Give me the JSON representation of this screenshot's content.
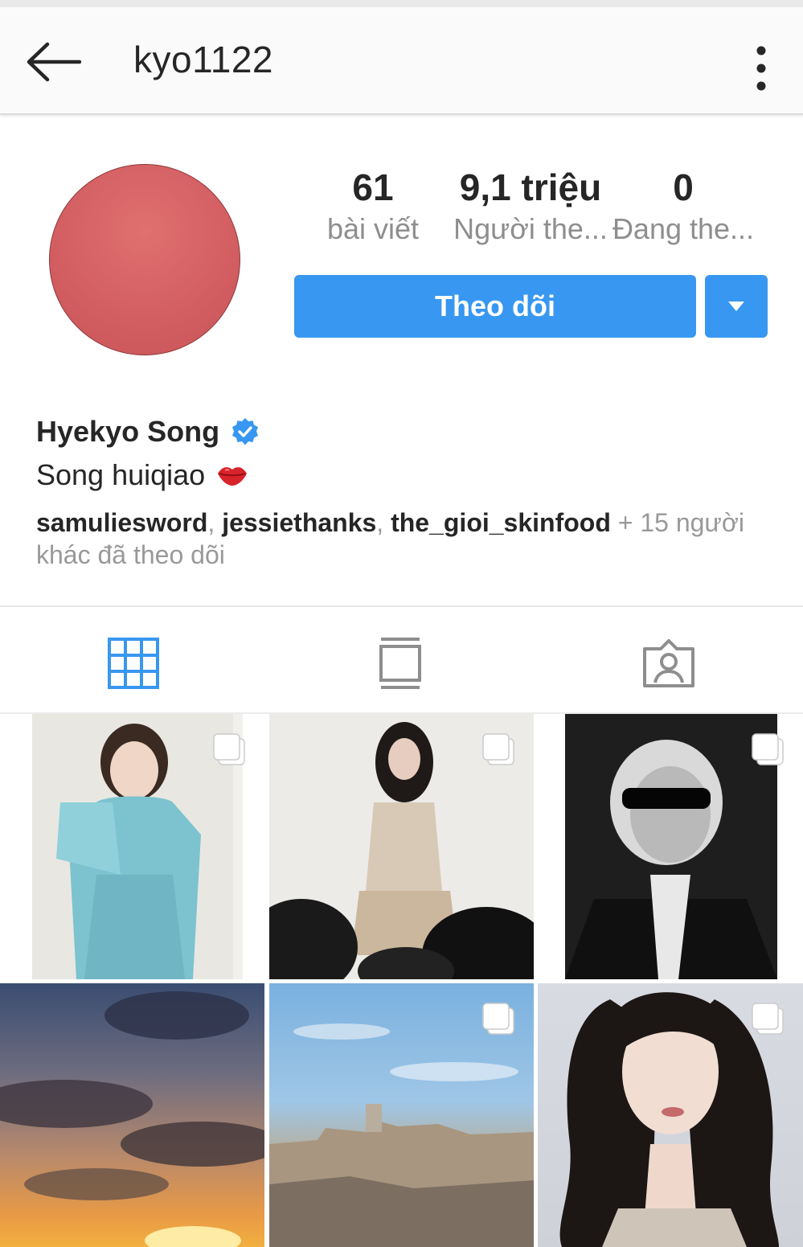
{
  "header": {
    "title": "kyo1122",
    "back_icon": "arrow-left-icon",
    "more_icon": "more-vertical-icon"
  },
  "profile": {
    "avatar_color": "#d35f62",
    "stats": {
      "posts": {
        "value": "61",
        "label": "bài viết"
      },
      "followers": {
        "value": "9,1 triệu",
        "label": "Người the..."
      },
      "following": {
        "value": "0",
        "label": "Đang the..."
      }
    },
    "follow_button": "Theo dõi",
    "name": "Hyekyo Song",
    "verified": true,
    "bio": "Song huiqiao",
    "followed_by": {
      "users": [
        "samuliesword",
        "jessiethanks",
        "the_gioi_skinfood"
      ],
      "separator": ", ",
      "suffix_1": " + 15 người",
      "suffix_2": "khác đã theo dõi"
    }
  },
  "tabs": [
    {
      "name": "grid",
      "icon": "grid-icon",
      "active": true
    },
    {
      "name": "feed",
      "icon": "feed-icon",
      "active": false
    },
    {
      "name": "tagged",
      "icon": "tagged-person-icon",
      "active": false
    }
  ],
  "colors": {
    "accent": "#3897f0",
    "active_tab": "#3897f0",
    "inactive_tab": "#8e8e8e",
    "text": "#262626",
    "muted": "#8e8e8e"
  }
}
